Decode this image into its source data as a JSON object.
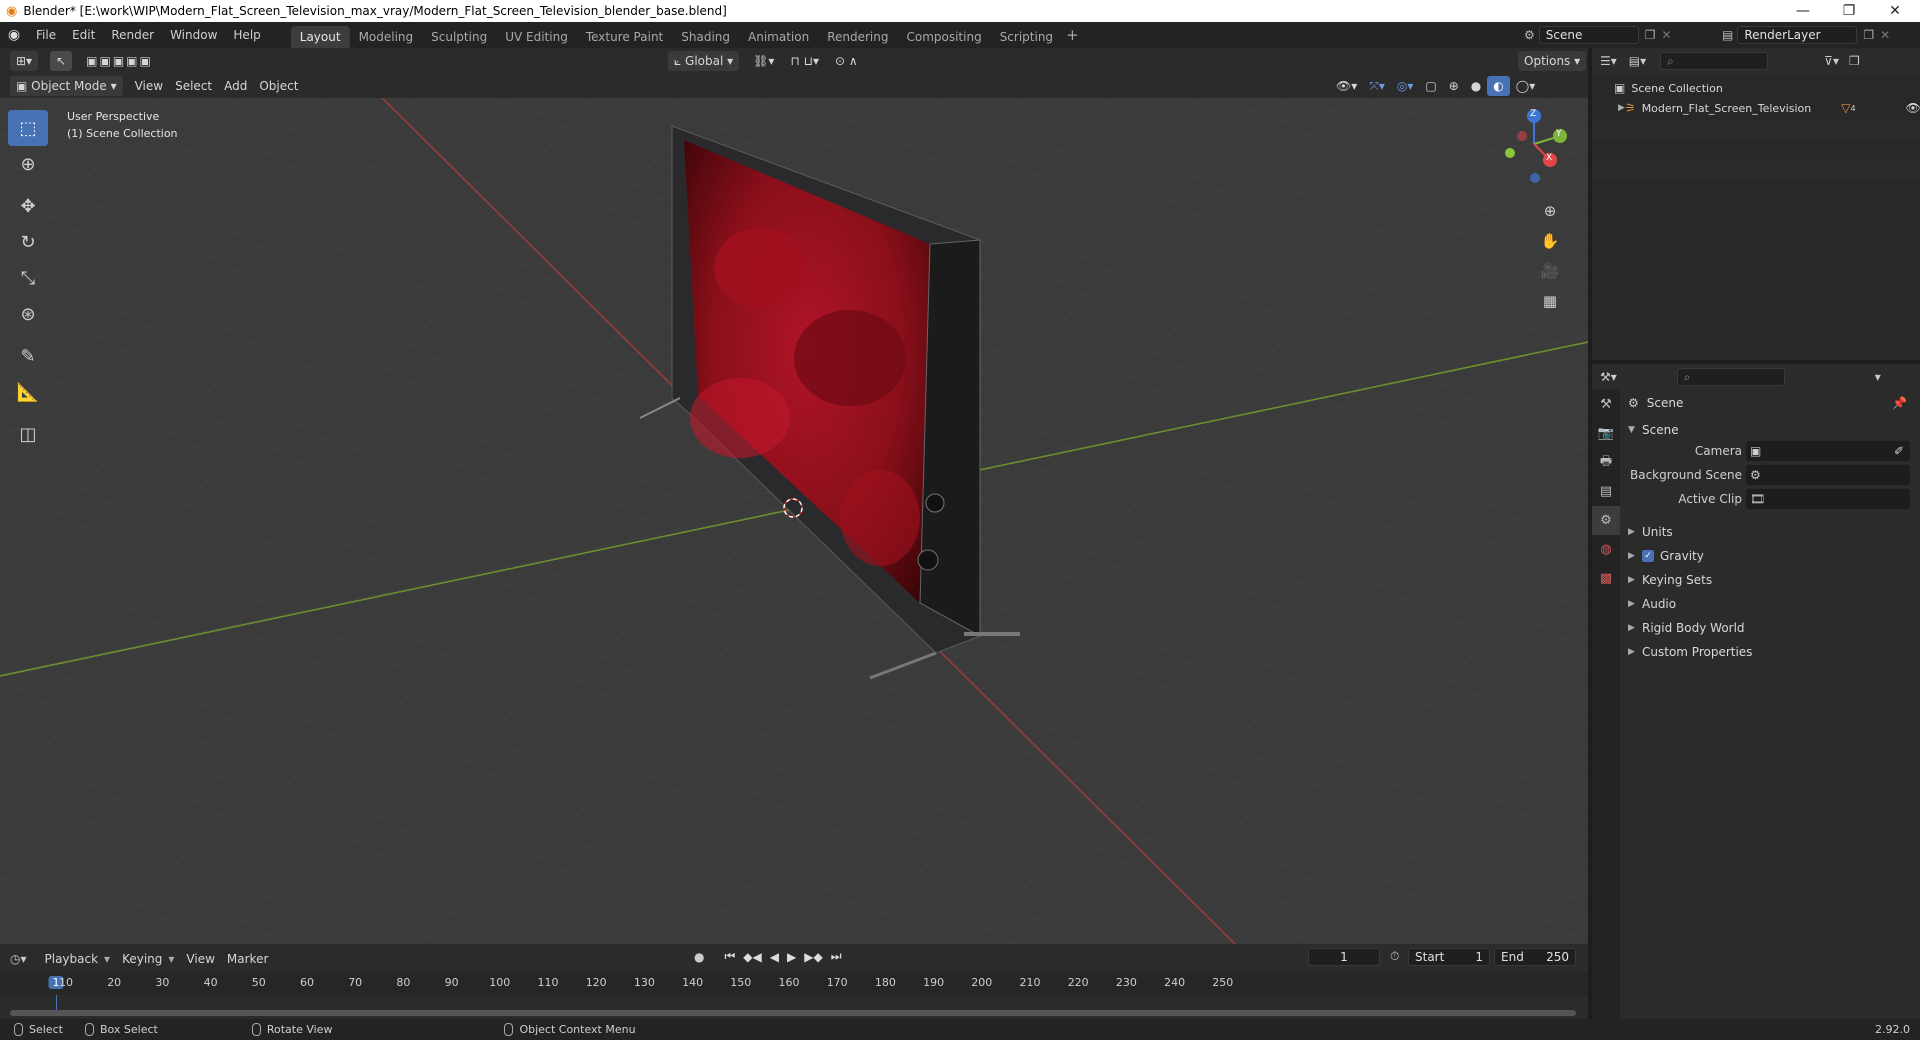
{
  "window": {
    "title": "Blender* [E:\\work\\WIP\\Modern_Flat_Screen_Television_max_vray/Modern_Flat_Screen_Television_blender_base.blend]",
    "minimize": "—",
    "restore": "❐",
    "close": "✕"
  },
  "menus": [
    "File",
    "Edit",
    "Render",
    "Window",
    "Help"
  ],
  "workspaces": [
    "Layout",
    "Modeling",
    "Sculpting",
    "UV Editing",
    "Texture Paint",
    "Shading",
    "Animation",
    "Rendering",
    "Compositing",
    "Scripting"
  ],
  "active_workspace": "Layout",
  "add_workspace": "+",
  "scene_field": "Scene",
  "renderlayer_field": "RenderLayer",
  "viewport_header": {
    "mode": "Object Mode",
    "menus": [
      "View",
      "Select",
      "Add",
      "Object"
    ],
    "transform_orientation": "Global",
    "options": "Options"
  },
  "viewport": {
    "perspective_label": "User Perspective",
    "collection_label": "(1) Scene Collection",
    "gizmo_axes": {
      "x": "X",
      "y": "Y",
      "z": "Z"
    },
    "colors": {
      "x_axis": "#9a3b3b",
      "y_axis": "#6b8f2d",
      "screen": "#8a0f1a",
      "tool_active": "#4772b3"
    }
  },
  "toolbar_icons": [
    "select-box-icon",
    "cursor-icon",
    "move-icon",
    "rotate-icon",
    "scale-icon",
    "transform-icon",
    "annotate-icon",
    "measure-icon",
    "add-cube-icon"
  ],
  "outliner": {
    "root": "Scene Collection",
    "items": [
      {
        "label": "Modern_Flat_Screen_Television",
        "badge": "4"
      }
    ]
  },
  "properties": {
    "header": "Scene",
    "section": "Scene",
    "fields": [
      {
        "label": "Camera",
        "value": ""
      },
      {
        "label": "Background Scene",
        "value": ""
      },
      {
        "label": "Active Clip",
        "value": ""
      }
    ],
    "panels": [
      "Units",
      "Gravity",
      "Keying Sets",
      "Audio",
      "Rigid Body World",
      "Custom Properties"
    ],
    "gravity_checked": true
  },
  "timeline": {
    "menus": [
      "Playback",
      "Keying",
      "View",
      "Marker"
    ],
    "current_frame": "1",
    "start_label": "Start",
    "start_value": "1",
    "end_label": "End",
    "end_value": "250",
    "ruler": [
      "1",
      "10",
      "20",
      "30",
      "40",
      "50",
      "60",
      "70",
      "80",
      "90",
      "100",
      "110",
      "120",
      "130",
      "140",
      "150",
      "160",
      "170",
      "180",
      "190",
      "200",
      "210",
      "220",
      "230",
      "240",
      "250"
    ]
  },
  "statusbar": {
    "select": "Select",
    "box_select": "Box Select",
    "rotate_view": "Rotate View",
    "context_menu": "Object Context Menu",
    "version": "2.92.0"
  }
}
